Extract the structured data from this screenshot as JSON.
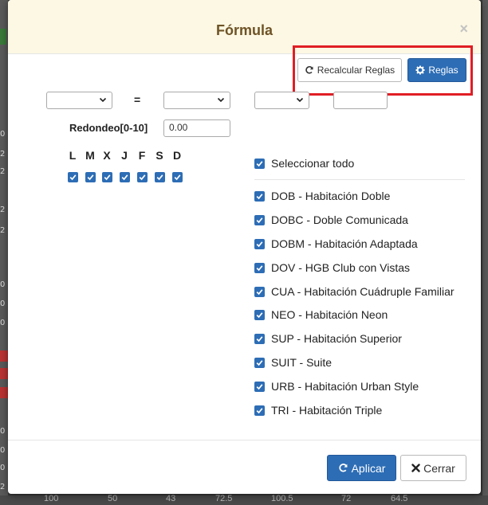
{
  "background": {
    "left_numbers": [
      "0",
      "2",
      "2",
      "2",
      "2",
      "0",
      "0",
      "0",
      "0",
      "0",
      "0",
      "2"
    ],
    "bottom_values": [
      "100",
      "50",
      "43",
      "72.5",
      "100.5",
      "72",
      "64.5"
    ]
  },
  "modal": {
    "title": "Fórmula",
    "close_symbol": "×",
    "toolbar": {
      "recalcular_label": "Recalcular Reglas",
      "reglas_label": "Reglas"
    },
    "formula": {
      "operator": "=",
      "select_1": "",
      "select_2": "",
      "select_3": "",
      "value_input": ""
    },
    "redondeo": {
      "label": "Redondeo[0-10]",
      "value": "0.00"
    },
    "days": [
      "L",
      "M",
      "X",
      "J",
      "F",
      "S",
      "D"
    ],
    "days_checked": [
      true,
      true,
      true,
      true,
      true,
      true,
      true
    ],
    "select_all_label": "Seleccionar todo",
    "rooms": [
      "DOB - Habitación Doble",
      "DOBC - Doble Comunicada",
      "DOBM - Habitación Adaptada",
      "DOV - HGB Club con Vistas",
      "CUA - Habitación Cuádruple Familiar",
      "NEO - Habitación Neon",
      "SUP - Habitación Superior",
      "SUIT - Suite",
      "URB - Habitación Urban Style",
      "TRI - Habitación Triple"
    ],
    "footer": {
      "apply_label": "Aplicar",
      "close_label": "Cerrar"
    },
    "colors": {
      "primary": "#2d6db5",
      "header_bg": "#fcf8e3",
      "title": "#6e5326",
      "highlight": "#e01e25"
    }
  }
}
